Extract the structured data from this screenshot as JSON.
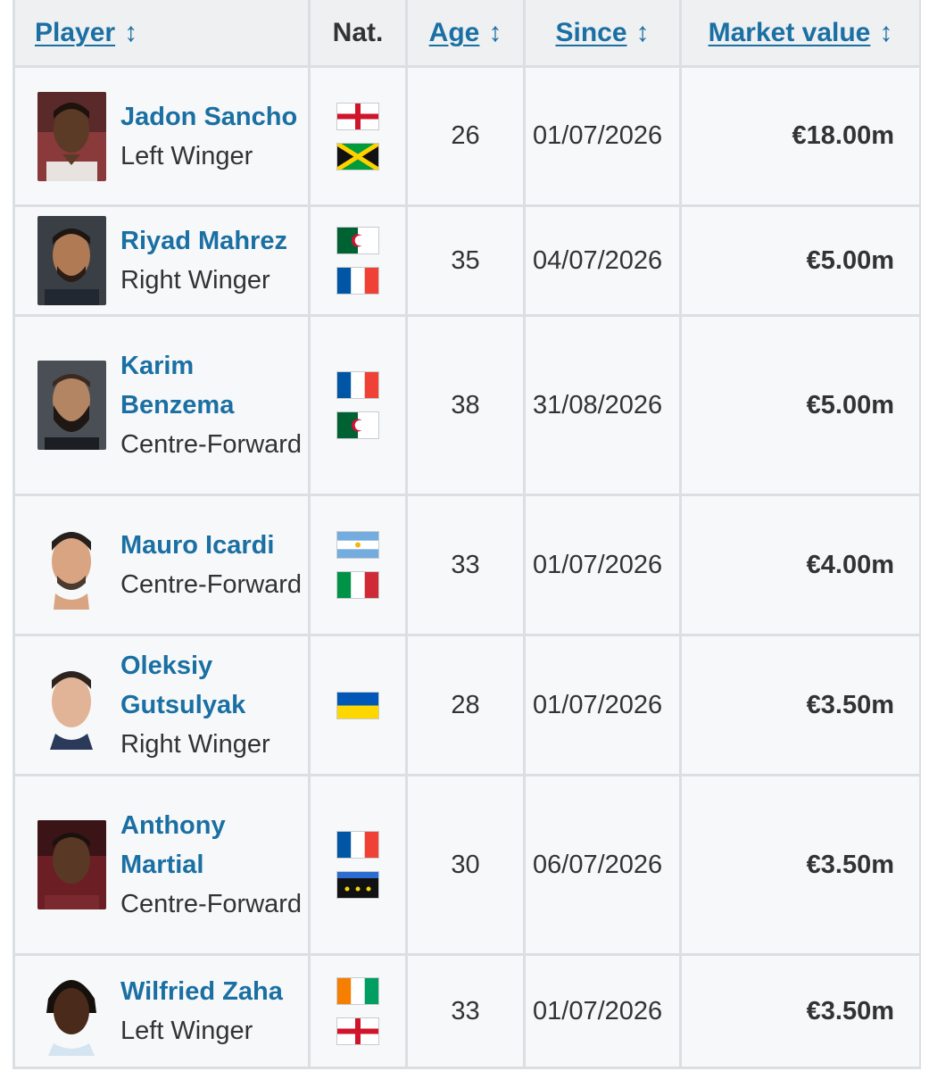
{
  "header": {
    "player": "Player",
    "nat": "Nat.",
    "age": "Age",
    "since": "Since",
    "market_value": "Market value",
    "sort_glyph": "↕"
  },
  "players": [
    {
      "name": "Jadon Sancho",
      "position": "Left Winger",
      "nationalities": [
        "England",
        "Jamaica"
      ],
      "age": "26",
      "since": "01/07/2026",
      "value": "€18.00m"
    },
    {
      "name": "Riyad Mahrez",
      "position": "Right Winger",
      "nationalities": [
        "Algeria",
        "France"
      ],
      "age": "35",
      "since": "04/07/2026",
      "value": "€5.00m"
    },
    {
      "name": "Karim Benzema",
      "position": "Centre-Forward",
      "nationalities": [
        "France",
        "Algeria"
      ],
      "age": "38",
      "since": "31/08/2026",
      "value": "€5.00m"
    },
    {
      "name": "Mauro Icardi",
      "position": "Centre-Forward",
      "nationalities": [
        "Argentina",
        "Italy"
      ],
      "age": "33",
      "since": "01/07/2026",
      "value": "€4.00m"
    },
    {
      "name": "Oleksiy Gutsulyak",
      "position": "Right Winger",
      "nationalities": [
        "Ukraine"
      ],
      "age": "28",
      "since": "01/07/2026",
      "value": "€3.50m"
    },
    {
      "name": "Anthony Martial",
      "position": "Centre-Forward",
      "nationalities": [
        "France",
        "Guadeloupe"
      ],
      "age": "30",
      "since": "06/07/2026",
      "value": "€3.50m"
    },
    {
      "name": "Wilfried Zaha",
      "position": "Left Winger",
      "nationalities": [
        "Cote d'Ivoire",
        "England"
      ],
      "age": "33",
      "since": "01/07/2026",
      "value": "€3.50m"
    }
  ],
  "colors": {
    "link": "#1a6fa3",
    "text": "#333333",
    "header_bg": "#eef0f2",
    "row_bg": "#f7f8f9",
    "grid": "#dcdfe2"
  }
}
